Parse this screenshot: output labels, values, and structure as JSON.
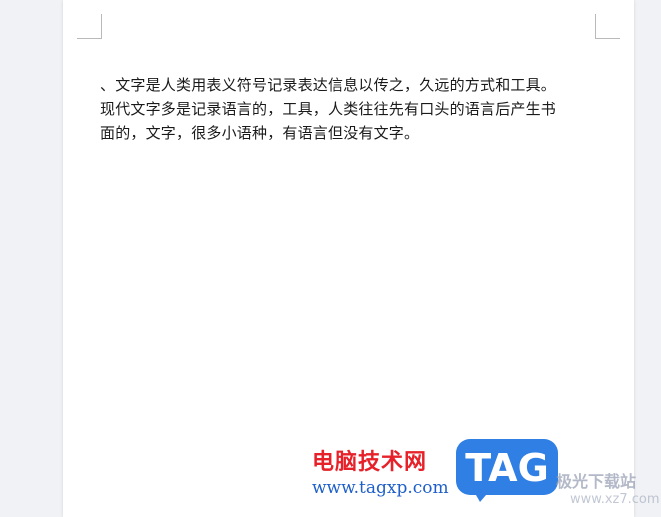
{
  "document": {
    "lines": [
      "、文字是人类用表义符号记录表达信息以传之，久远的方式和工具。",
      "现代文字多是记录语言的，工具，人类往往先有口头的语言后产生书",
      "面的，文字，很多小语种，有语言但没有文字。"
    ]
  },
  "watermark": {
    "site_name": "电脑技术网",
    "site_url": "www.tagxp.com",
    "logo_text": "TAG",
    "partner_name": "极光下载站",
    "partner_url": "www.xz7.com",
    "colors": {
      "site_name": "#e62129",
      "site_url": "#1e5fc9",
      "logo_bg": "#2f7fe4"
    }
  }
}
